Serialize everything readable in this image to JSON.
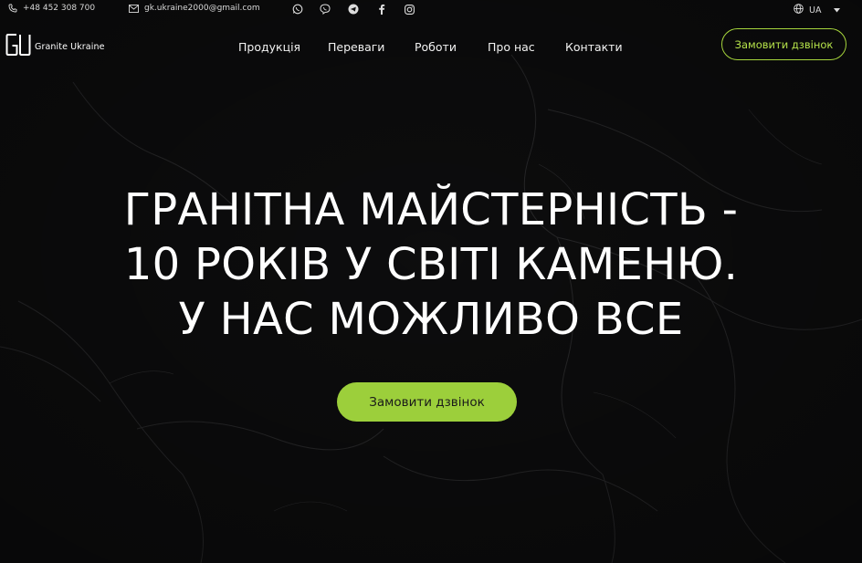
{
  "topbar": {
    "phone": "+48 452 308 700",
    "email": "gk.ukraine2000@gmail.com",
    "social_icons": [
      "whatsapp-icon",
      "viber-icon",
      "telegram-icon",
      "facebook-icon",
      "instagram-icon"
    ],
    "language": "UA"
  },
  "header": {
    "logo_text": "Granite Ukraine",
    "nav": [
      "Продукція",
      "Переваги",
      "Роботи",
      "Про нас",
      "Контакти"
    ],
    "cta_label": "Замовити дзвінок"
  },
  "hero": {
    "title_lines": [
      "ГРАНІТНА МАЙСТЕРНІСТЬ -",
      "10 РОКІВ У СВІТІ КАМЕНЮ.",
      "У НАС МОЖЛИВО ВСЕ"
    ],
    "cta_label": "Замовити дзвінок"
  },
  "colors": {
    "accent": "#9ccf3b",
    "background": "#0e0e0f"
  }
}
